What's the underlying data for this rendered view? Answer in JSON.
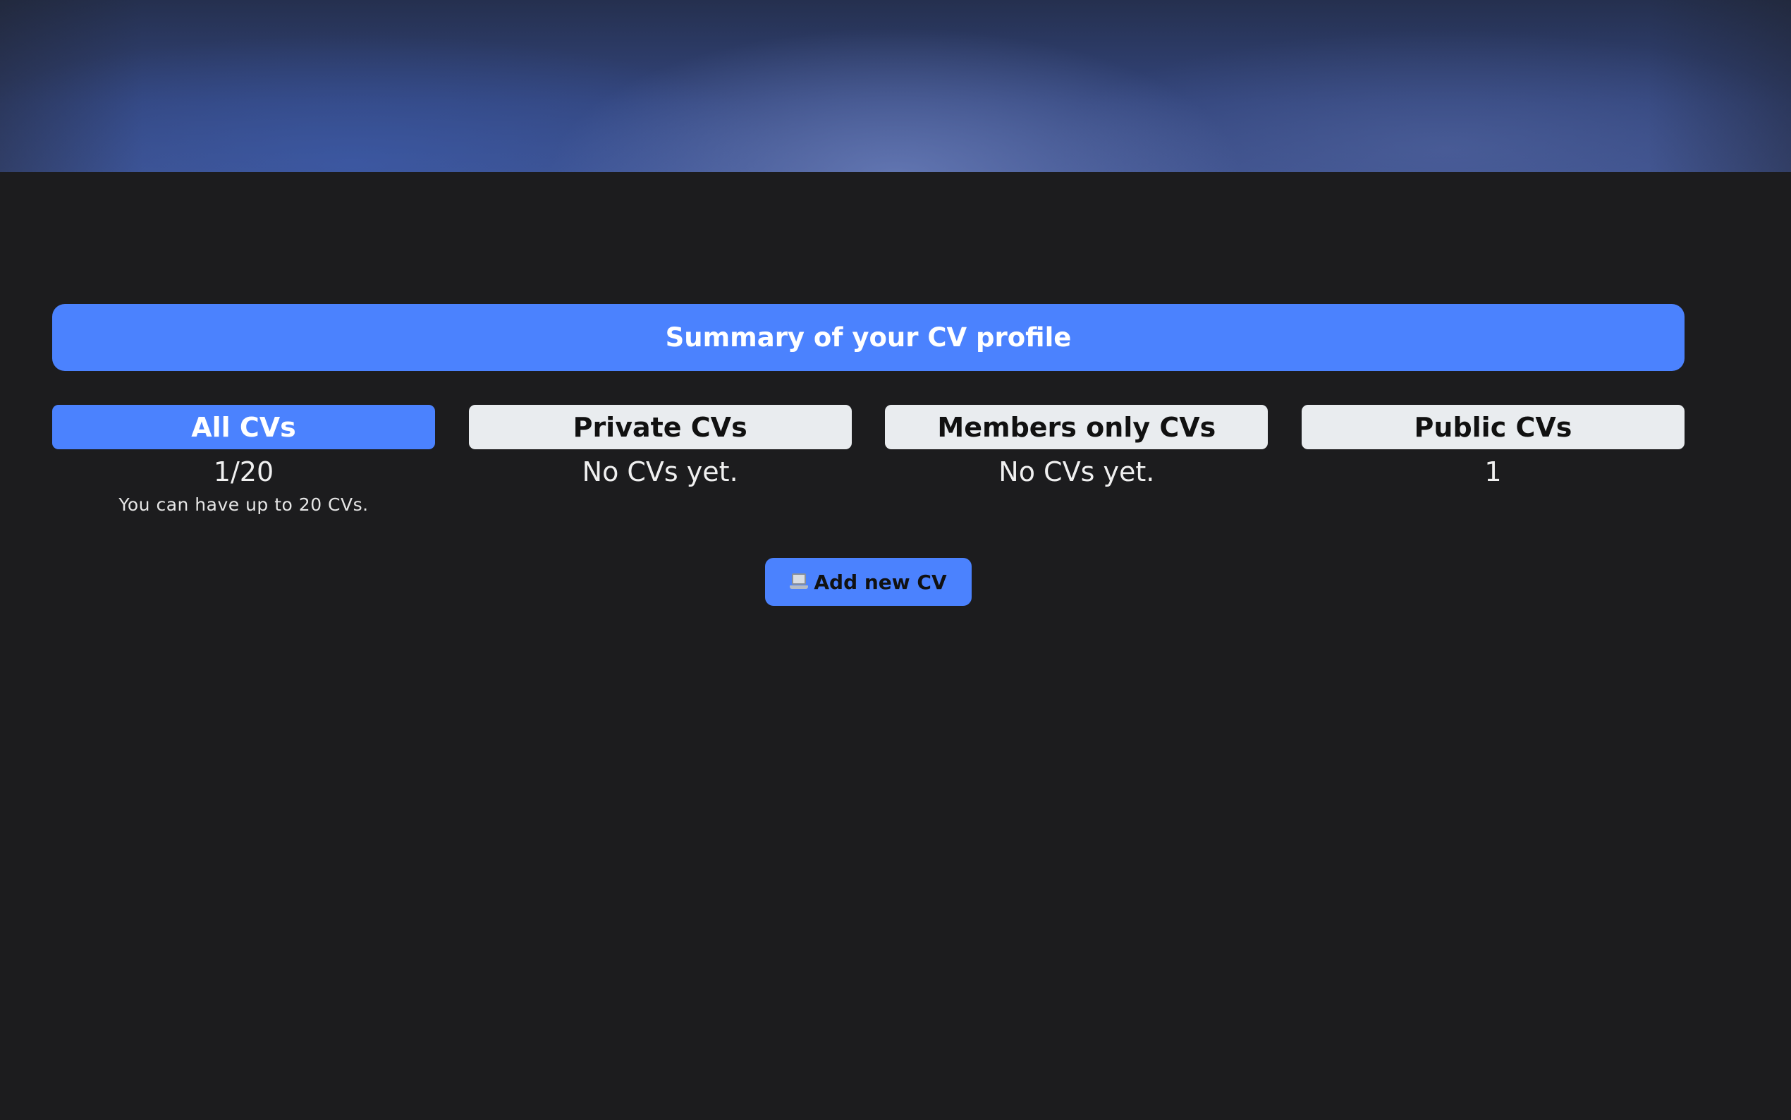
{
  "summary": {
    "title": "Summary of your CV profile"
  },
  "cards": [
    {
      "label": "All CVs",
      "value": "1/20",
      "note": "You can have up to 20 CVs."
    },
    {
      "label": "Private CVs",
      "value": "No CVs yet."
    },
    {
      "label": "Members only CVs",
      "value": "No CVs yet."
    },
    {
      "label": "Public CVs",
      "value": "1"
    }
  ],
  "actions": {
    "add_cv_label": "Add new CV",
    "add_cv_icon": "laptop-icon"
  },
  "colors": {
    "accent": "#4b82fe",
    "background": "#1c1c1e",
    "inactive_tab": "#e9ecef"
  }
}
